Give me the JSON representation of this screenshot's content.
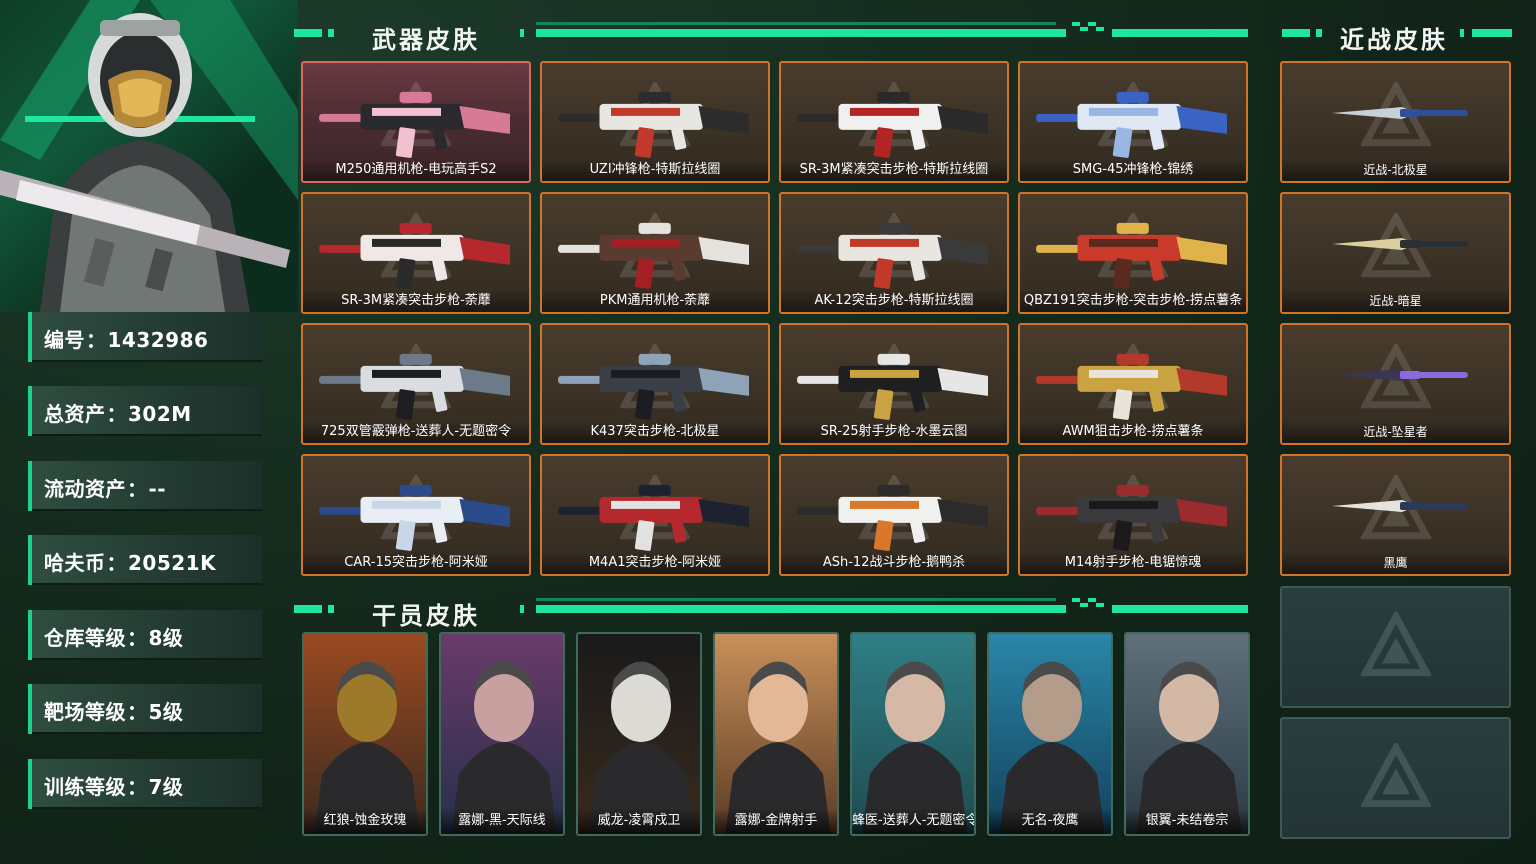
{
  "sections": {
    "weapons_title": "武器皮肤",
    "melee_title": "近战皮肤",
    "operators_title": "干员皮肤"
  },
  "stats": [
    {
      "label": "编号",
      "value": "1432986"
    },
    {
      "label": "总资产",
      "value": "302M"
    },
    {
      "label": "流动资产",
      "value": "--"
    },
    {
      "label": "哈夫币",
      "value": "20521K"
    },
    {
      "label": "仓库等级",
      "value": "8级"
    },
    {
      "label": "靶场等级",
      "value": "5级"
    },
    {
      "label": "训练等级",
      "value": "7级"
    }
  ],
  "stat_separator": "：",
  "weapons": [
    {
      "name": "M250通用机枪-电玩高手S2"
    },
    {
      "name": "UZI冲锋枪-特斯拉线圈"
    },
    {
      "name": "SR-3M紧凑突击步枪-特斯拉线圈"
    },
    {
      "name": "SMG-45冲锋枪-锦绣"
    },
    {
      "name": "SR-3M紧凑突击步枪-荼蘼"
    },
    {
      "name": "PKM通用机枪-荼蘼"
    },
    {
      "name": "AK-12突击步枪-特斯拉线圈"
    },
    {
      "name": "QBZ191突击步枪-突击步枪-捞点薯条"
    },
    {
      "name": "725双管霰弹枪-送葬人-无题密令"
    },
    {
      "name": "K437突击步枪-北极星"
    },
    {
      "name": "SR-25射手步枪-水墨云图"
    },
    {
      "name": "AWM狙击步枪-捞点薯条"
    },
    {
      "name": "CAR-15突击步枪-阿米娅"
    },
    {
      "name": "M4A1突击步枪-阿米娅"
    },
    {
      "name": "ASh-12战斗步枪-鹅鸭杀"
    },
    {
      "name": "M14射手步枪-电锯惊魂"
    }
  ],
  "melee": [
    {
      "name": "近战-北极星"
    },
    {
      "name": "近战-暗星"
    },
    {
      "name": "近战-坠星者"
    },
    {
      "name": "黑鹰"
    }
  ],
  "operators": [
    {
      "name": "红狼-蚀金玫瑰"
    },
    {
      "name": "露娜-黑-天际线"
    },
    {
      "name": "威龙-凌霄戍卫"
    },
    {
      "name": "露娜-金牌射手"
    },
    {
      "name": "蜂医-送葬人-无题密令"
    },
    {
      "name": "无名-夜鹰"
    },
    {
      "name": "银翼-未结卷宗"
    }
  ],
  "colors": {
    "accent": "#1ee6a0",
    "card_border": "#d0742a",
    "background": "#132a1e"
  }
}
